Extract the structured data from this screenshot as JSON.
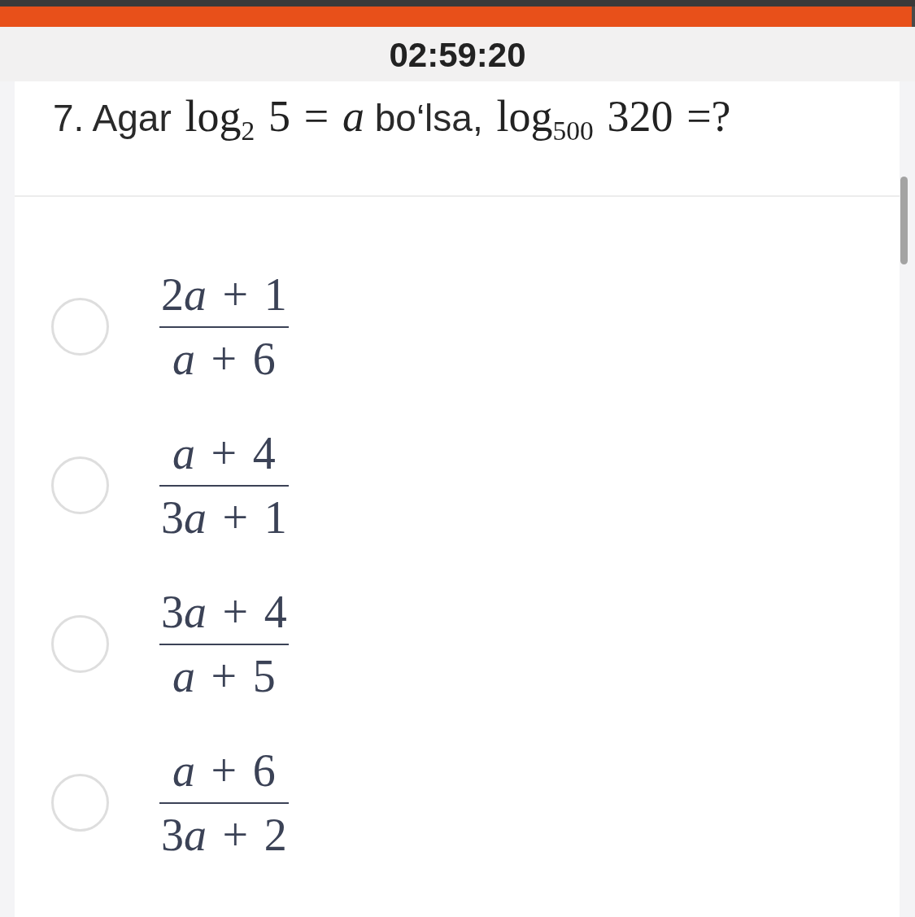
{
  "progress_bar": {
    "level": 0.996
  },
  "timer": "02:59:20",
  "question": {
    "segments": [
      {
        "kind": "text",
        "text": "7. Agar"
      },
      {
        "kind": "math",
        "text": "log$_{2}$ 5 = *a*"
      },
      {
        "kind": "text",
        "text": "bo‘lsa,"
      },
      {
        "kind": "math",
        "text": "log$_{500}$ 320 =?"
      }
    ]
  },
  "options": [
    {
      "selected": false,
      "numerator": "2a + 1",
      "denominator": "a + 6"
    },
    {
      "selected": false,
      "numerator": "a + 4",
      "denominator": "3a + 1"
    },
    {
      "selected": false,
      "numerator": "3a + 4",
      "denominator": "a + 5"
    },
    {
      "selected": false,
      "numerator": "a + 6",
      "denominator": "3a + 2"
    }
  ]
}
